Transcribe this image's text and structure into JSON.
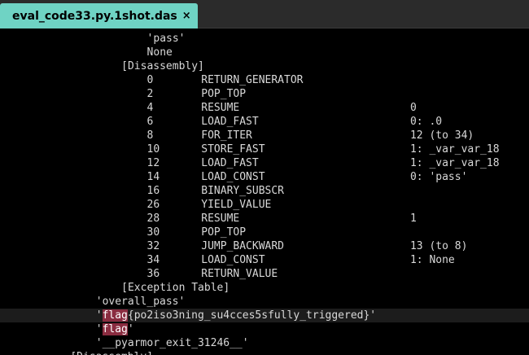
{
  "tab": {
    "title": "eval_code33.py.1shot.das",
    "close_glyph": "×"
  },
  "lines": [
    {
      "indent": 23,
      "text": "'pass'"
    },
    {
      "indent": 23,
      "text": "None"
    },
    {
      "indent": 19,
      "text": "[Disassembly]"
    },
    {
      "indent": 23,
      "offset": "0",
      "op": "RETURN_GENERATOR",
      "arg": ""
    },
    {
      "indent": 23,
      "offset": "2",
      "op": "POP_TOP",
      "arg": ""
    },
    {
      "indent": 23,
      "offset": "4",
      "op": "RESUME",
      "arg": "0"
    },
    {
      "indent": 23,
      "offset": "6",
      "op": "LOAD_FAST",
      "arg": "0: .0"
    },
    {
      "indent": 23,
      "offset": "8",
      "op": "FOR_ITER",
      "arg": "12 (to 34)"
    },
    {
      "indent": 23,
      "offset": "10",
      "op": "STORE_FAST",
      "arg": "1: _var_var_18"
    },
    {
      "indent": 23,
      "offset": "12",
      "op": "LOAD_FAST",
      "arg": "1: _var_var_18"
    },
    {
      "indent": 23,
      "offset": "14",
      "op": "LOAD_CONST",
      "arg": "0: 'pass'"
    },
    {
      "indent": 23,
      "offset": "16",
      "op": "BINARY_SUBSCR",
      "arg": ""
    },
    {
      "indent": 23,
      "offset": "26",
      "op": "YIELD_VALUE",
      "arg": ""
    },
    {
      "indent": 23,
      "offset": "28",
      "op": "RESUME",
      "arg": "1"
    },
    {
      "indent": 23,
      "offset": "30",
      "op": "POP_TOP",
      "arg": ""
    },
    {
      "indent": 23,
      "offset": "32",
      "op": "JUMP_BACKWARD",
      "arg": "13 (to 8)"
    },
    {
      "indent": 23,
      "offset": "34",
      "op": "LOAD_CONST",
      "arg": "1: None"
    },
    {
      "indent": 23,
      "offset": "36",
      "op": "RETURN_VALUE",
      "arg": ""
    },
    {
      "indent": 19,
      "text": "[Exception Table]"
    },
    {
      "indent": 15,
      "text": "'overall_pass'"
    },
    {
      "indent": 15,
      "pre": "'",
      "hl": "flag",
      "post": "{po2iso3ning_su4cces5sfully_triggered}'",
      "current": true
    },
    {
      "indent": 15,
      "pre": "'",
      "hl": "flag",
      "post": "'"
    },
    {
      "indent": 15,
      "text": "'__pyarmor_exit_31246__'"
    },
    {
      "indent": 11,
      "text": "[Disassembly]"
    }
  ],
  "colors": {
    "background": "#000000",
    "text": "#d8d8d8",
    "tab_active": "#6fd3c4",
    "search_highlight": "#8a2c40"
  }
}
